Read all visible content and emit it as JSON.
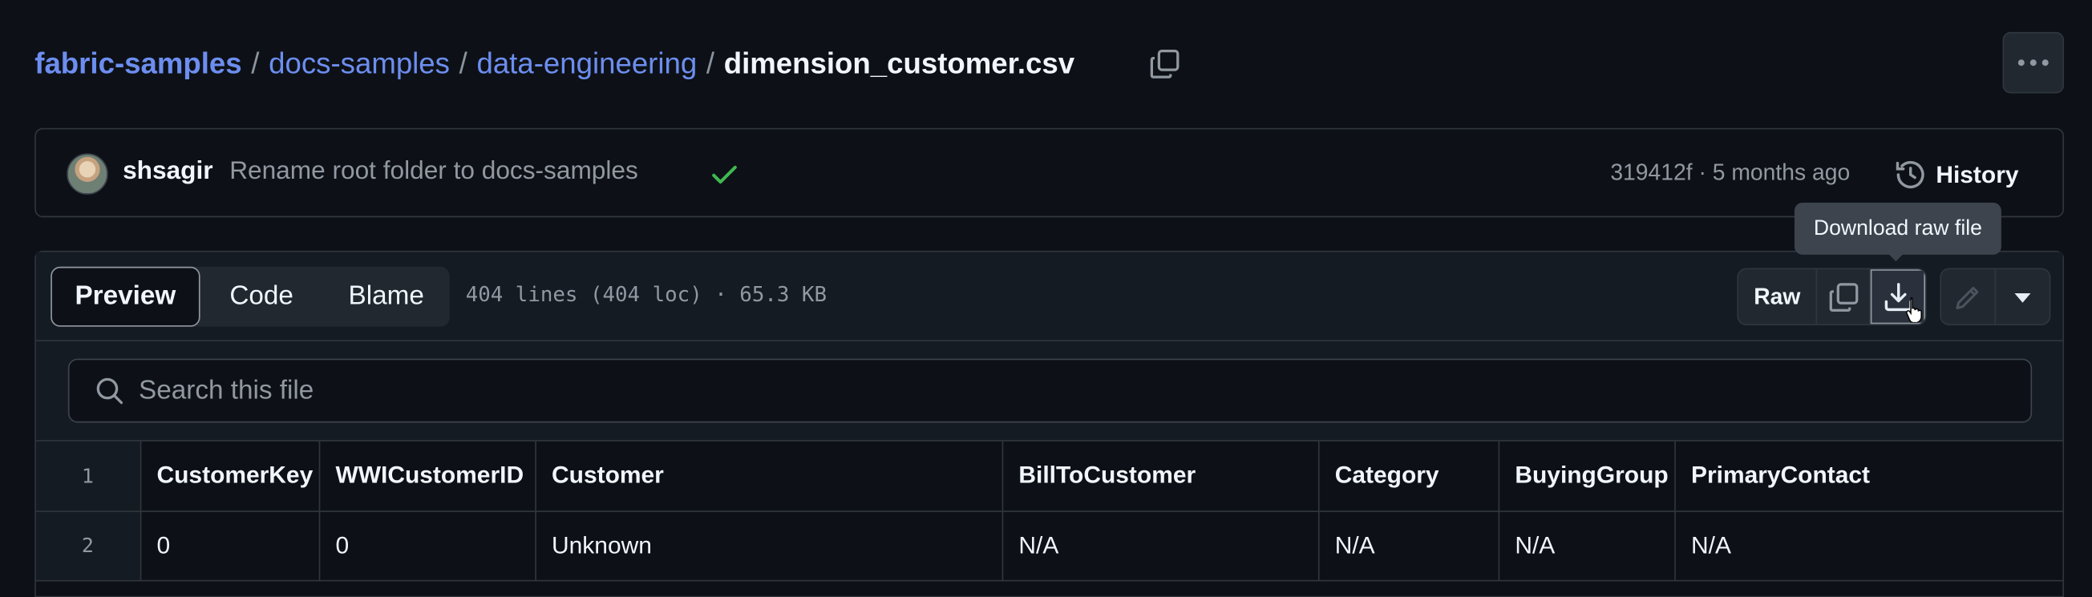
{
  "breadcrumb": {
    "repo": "fabric-samples",
    "folders": [
      "docs-samples",
      "data-engineering"
    ],
    "separator": "/",
    "current_file": "dimension_customer.csv"
  },
  "commit": {
    "author": "shsagir",
    "message": "Rename root folder to docs-samples",
    "hash": "319412f",
    "dot": "·",
    "time": "5 months ago",
    "history_label": "History"
  },
  "tooltip": "Download raw file",
  "view_tabs": [
    {
      "label": "Preview",
      "active": true
    },
    {
      "label": "Code",
      "active": false
    },
    {
      "label": "Blame",
      "active": false
    }
  ],
  "file_stats": "404 lines (404 loc) · 65.3 KB",
  "actions": {
    "raw_label": "Raw"
  },
  "search": {
    "placeholder": "Search this file",
    "value": ""
  },
  "table": {
    "header_line_number": "1",
    "columns": [
      "CustomerKey",
      "WWICustomerID",
      "Customer",
      "BillToCustomer",
      "Category",
      "BuyingGroup",
      "PrimaryContact"
    ],
    "rows": [
      {
        "line": "2",
        "cells": [
          "0",
          "0",
          "Unknown",
          "N/A",
          "N/A",
          "N/A",
          "N/A"
        ]
      }
    ]
  },
  "colors": {
    "background": "#0d1117",
    "link": "#6d8ef0",
    "success": "#3fb950",
    "border": "#30363d"
  },
  "icons": {
    "copy_path": "copy-icon",
    "kebab": "kebab-horizontal-icon",
    "check": "check-icon",
    "history": "history-icon",
    "copy_raw": "copy-icon",
    "download": "download-icon",
    "edit": "pencil-icon",
    "dropdown": "triangle-down-icon",
    "search": "search-icon"
  }
}
